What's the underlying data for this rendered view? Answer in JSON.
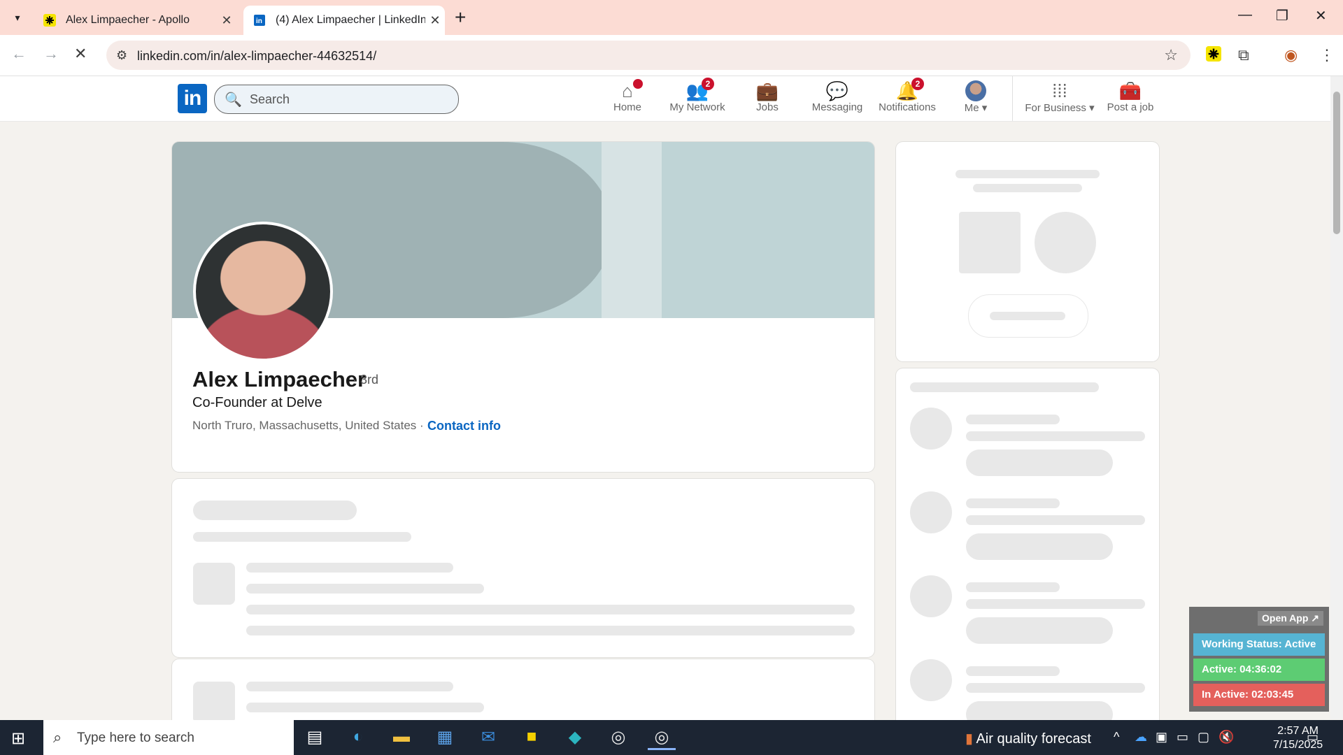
{
  "browser": {
    "tabs": [
      {
        "title": "Alex Limpaecher - Apollo",
        "favicon": "apollo-icon"
      },
      {
        "title": "(4) Alex Limpaecher | LinkedIn",
        "favicon": "linkedin-icon"
      }
    ],
    "url": "linkedin.com/in/alex-limpaecher-44632514/"
  },
  "header": {
    "logo": "in",
    "search_placeholder": "Search",
    "nav": [
      {
        "label": "Home",
        "badge": ""
      },
      {
        "label": "My Network",
        "badge": "2"
      },
      {
        "label": "Jobs",
        "badge": ""
      },
      {
        "label": "Messaging",
        "badge": ""
      },
      {
        "label": "Notifications",
        "badge": "2"
      },
      {
        "label": "Me",
        "badge": ""
      },
      {
        "label": "For Business",
        "badge": ""
      },
      {
        "label": "Post a job",
        "badge": ""
      }
    ]
  },
  "profile": {
    "name": "Alex Limpaecher",
    "degree": "· 3rd",
    "headline": "Co-Founder at Delve",
    "location": "North Truro, Massachusetts, United States ·",
    "contact": "Contact info"
  },
  "widget": {
    "open_app": "Open App ↗",
    "status": "Working Status: Active",
    "active": "Active: 04:36:02",
    "inactive": "In Active: 02:03:45"
  },
  "taskbar": {
    "search_placeholder": "Type here to search",
    "weather": "Air quality forecast",
    "time": "2:57 AM",
    "date": "7/15/2025"
  },
  "colors": {
    "linkedin_blue": "#0a66c2",
    "badge_red": "#cb112d",
    "status_blue": "#56b4d3",
    "active_green": "#5dcc73",
    "inactive_red": "#e4605c"
  }
}
